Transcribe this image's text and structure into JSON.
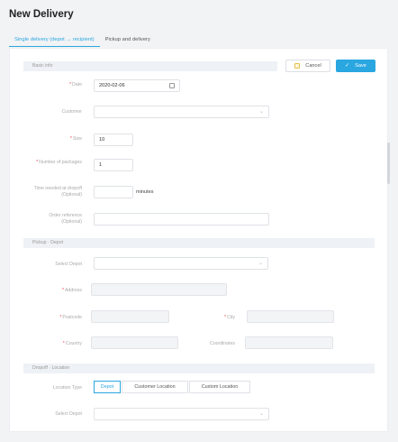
{
  "page": {
    "title": "New Delivery"
  },
  "tabs": [
    {
      "label": "Single delivery (depot → recipient)"
    },
    {
      "label": "Pickup and delivery"
    }
  ],
  "actions": {
    "cancel_label": "Cancel",
    "save_label": "Save"
  },
  "sections": {
    "basic": "Basic info",
    "pickup": "Pickup · Depot",
    "dropoff": "Dropoff · Location"
  },
  "basic": {
    "date_label": "Date",
    "date_value": "2020-02-06",
    "customer_label": "Customer",
    "customer_value": "",
    "size_label": "Size",
    "size_value": "10",
    "packages_label": "Number of packages",
    "packages_value": "1",
    "time_label": "Time needed at dropoff (Optional)",
    "time_value": "",
    "time_unit": "minutes",
    "order_label": "Order reference (Optional)",
    "order_value": ""
  },
  "pickup": {
    "depot_label": "Select Depot",
    "depot_value": "",
    "address_label": "Address",
    "address_value": "",
    "postcode_label": "Postcode",
    "postcode_value": "",
    "city_label": "City",
    "city_value": "",
    "country_label": "Country",
    "country_value": "",
    "coords_label": "Coordinates",
    "coords_value": ""
  },
  "dropoff": {
    "location_type_label": "Location Type",
    "location_types": [
      "Depot",
      "Customer Location",
      "Custom Location"
    ],
    "selected_location_type": "Depot",
    "depot_label": "Select Depot",
    "depot_value": ""
  },
  "icons": {
    "cancel": "cancel-doc-icon",
    "save": "check-icon",
    "calendar": "calendar-icon",
    "chevron": "chevron-down-icon"
  },
  "colors": {
    "accent": "#2aa7e0",
    "required": "#e45555"
  }
}
